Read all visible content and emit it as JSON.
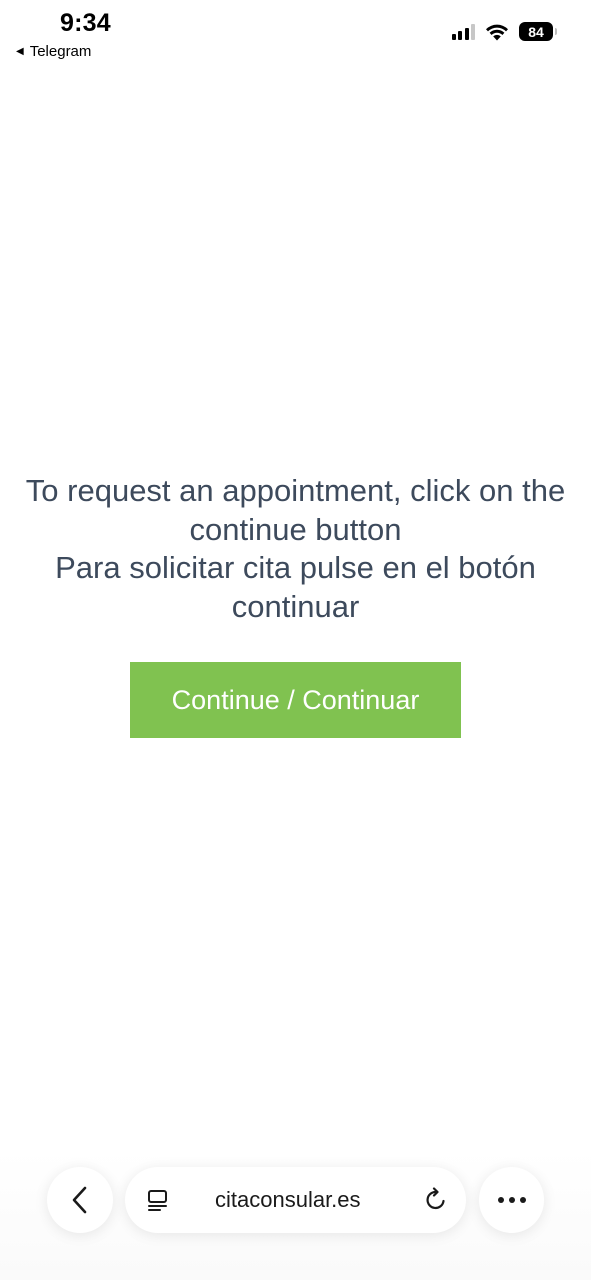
{
  "status_bar": {
    "time": "9:34",
    "back_app_label": "Telegram",
    "battery_level": "84"
  },
  "main": {
    "message_lines": [
      "To request an appointment, click on the",
      "continue button",
      "Para solicitar cita pulse en el botón",
      "continuar"
    ],
    "continue_label": "Continue / Continuar",
    "button_color": "#80c250",
    "text_color": "#3d4a5c"
  },
  "browser": {
    "url": "citaconsular.es",
    "icons": [
      "chevron-left-icon",
      "tabs-icon",
      "reload-icon",
      "more-dots-icon"
    ]
  }
}
